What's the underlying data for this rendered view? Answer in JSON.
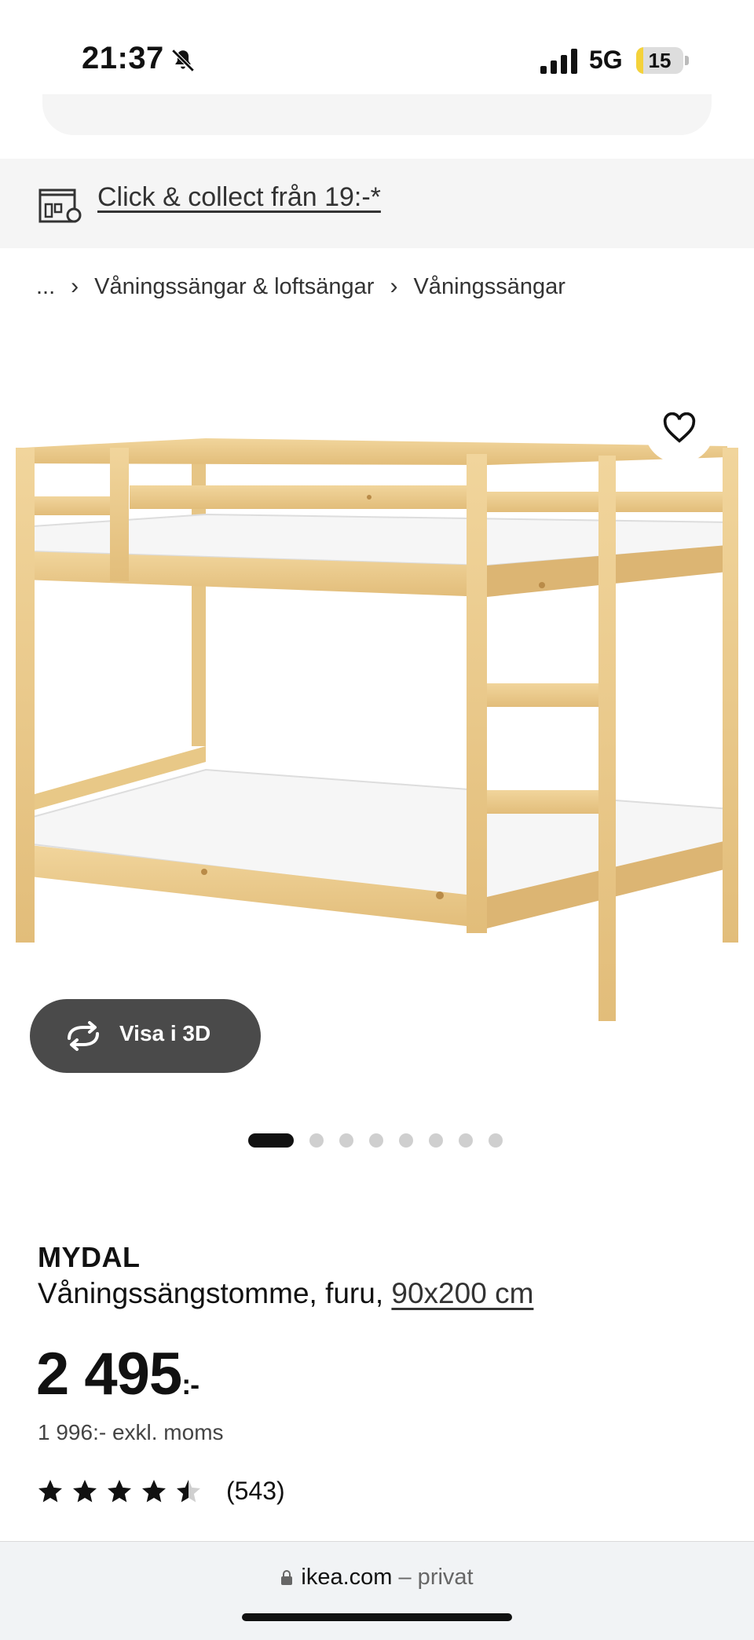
{
  "status_bar": {
    "time": "21:37",
    "network": "5G",
    "battery": "15",
    "battery_level": 0.15
  },
  "click_collect": {
    "label": "Click & collect från 19:-*"
  },
  "breadcrumb": {
    "ellipsis": "...",
    "items": [
      "Våningssängar & loftsängar",
      "Våningssängar"
    ]
  },
  "gallery": {
    "view3d_label": "Visa i 3D",
    "total_images": 8,
    "active_index": 0
  },
  "product": {
    "name": "MYDAL",
    "description": "Våningssängstomme, furu,",
    "size": "90x200 cm",
    "price": "2 495",
    "price_suffix": ":-",
    "price_excl_vat": "1 996:- exkl. moms",
    "rating_value": 4.5,
    "rating_count": "(543)"
  },
  "browser": {
    "domain": "ikea.com",
    "mode": "– privat"
  },
  "colors": {
    "wood": "#e9c98b",
    "wood_dark": "#c9a266",
    "mattress": "#f4f4f4",
    "button_dark": "#4a4a4a",
    "battery_yellow": "#f4d23a"
  }
}
